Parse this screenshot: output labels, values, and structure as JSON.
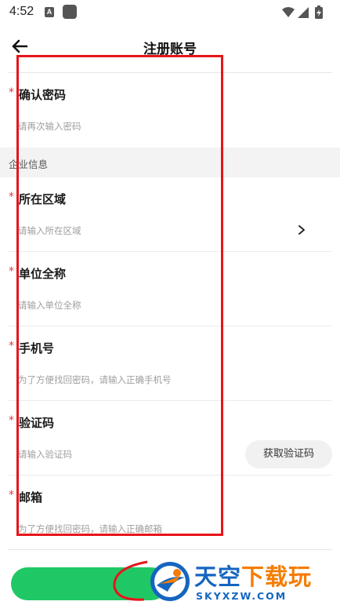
{
  "status_bar": {
    "time": "4:52",
    "left_icons": [
      "a-badge-icon",
      "app-square-icon"
    ],
    "right_icons": [
      "wifi-icon",
      "signal-icon",
      "battery-charging-icon"
    ]
  },
  "app_bar": {
    "title": "注册账号",
    "back_icon": "arrow-left-icon"
  },
  "form": {
    "confirm_password": {
      "required_mark": "*",
      "label": "确认密码",
      "placeholder": "请再次输入密码"
    },
    "section_company": "企业信息",
    "region": {
      "required_mark": "*",
      "label": "所在区域",
      "placeholder": "请输入所在区域",
      "chevron_icon": "chevron-right-icon"
    },
    "company_name": {
      "required_mark": "*",
      "label": "单位全称",
      "placeholder": "请输入单位全称"
    },
    "phone": {
      "required_mark": "*",
      "label": "手机号",
      "placeholder": "为了方便找回密码，请输入正确手机号"
    },
    "verify_code": {
      "required_mark": "*",
      "label": "验证码",
      "placeholder": "请输入验证码",
      "get_code_button": "获取验证码"
    },
    "email": {
      "required_mark": "*",
      "label": "邮箱",
      "placeholder": "为了方便找回密码，请输入正确邮箱"
    }
  },
  "watermark": {
    "text_main": "天空",
    "text_accent": "下载玩",
    "url": "SKYXZW.COM"
  },
  "colors": {
    "accent_green": "#1fc865",
    "required_red": "#e53935",
    "annotation_red": "#e8141a",
    "watermark_blue": "#1565c0",
    "watermark_orange": "#f57c00"
  }
}
